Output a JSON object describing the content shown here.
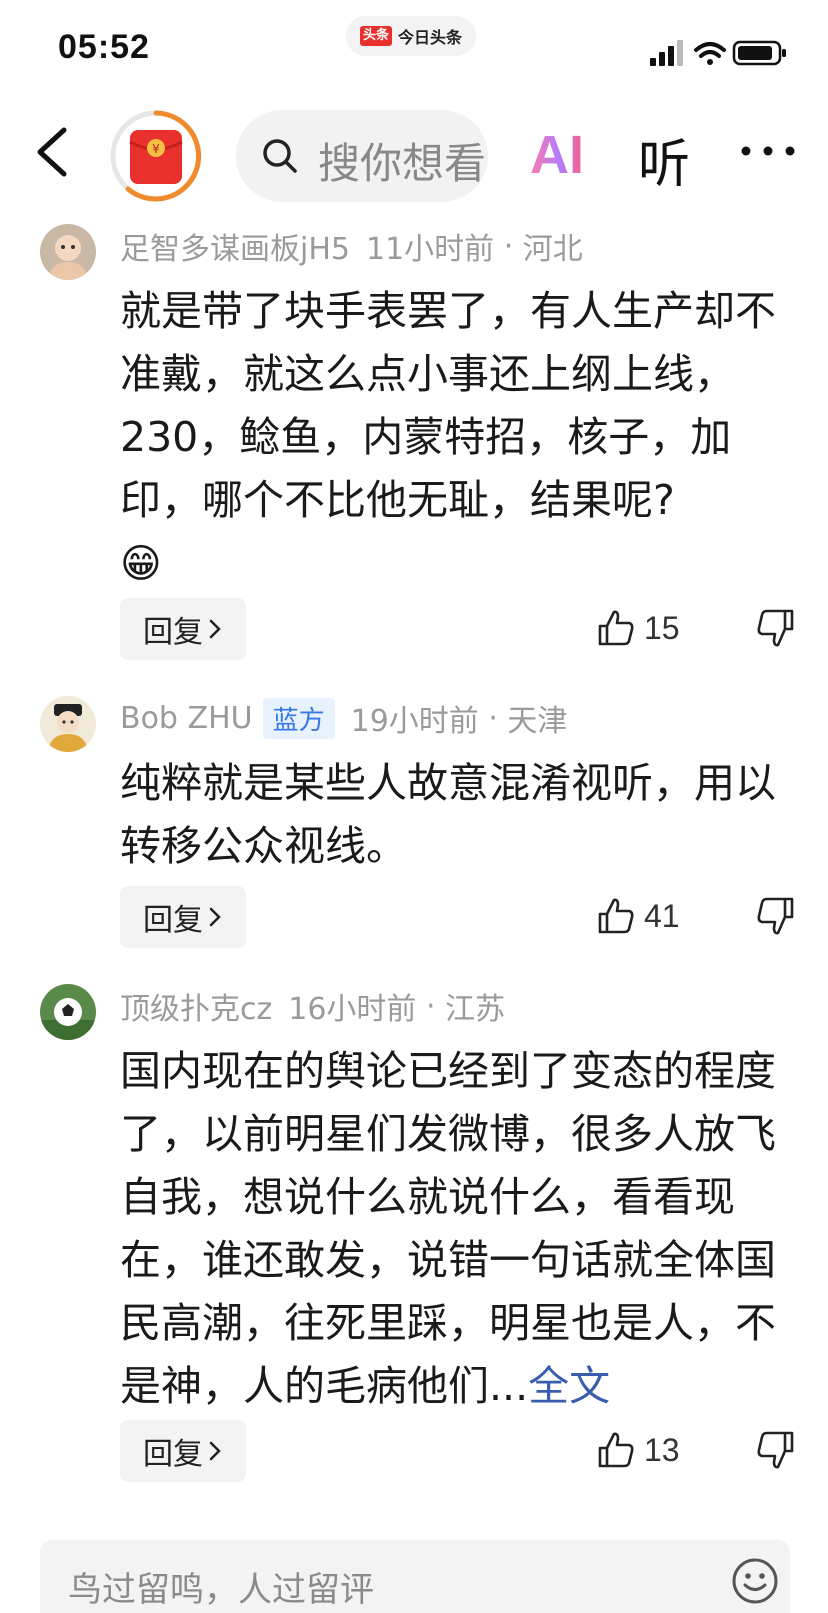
{
  "status_bar": {
    "time": "05:52",
    "app_logo": "头条",
    "app_name": "今日头条"
  },
  "nav": {
    "search_placeholder": "搜你想看",
    "ai_label": "AI",
    "listen_label": "听"
  },
  "comments": [
    {
      "username": "足智多谋画板jH5",
      "badge": "",
      "time": "11小时前",
      "location": "河北",
      "text": "就是带了块手表罢了，有人生产却不准戴，就这么点小事还上纲上线，230，鲶鱼，内蒙特招，核子，加印，哪个不比他无耻，结果呢?",
      "emoji": "😁",
      "more": "",
      "likes": "15",
      "reply_label": "回复"
    },
    {
      "username": "Bob ZHU",
      "badge": "蓝方",
      "time": "19小时前",
      "location": "天津",
      "text": "纯粹就是某些人故意混淆视听，用以转移公众视线。",
      "emoji": "",
      "more": "",
      "likes": "41",
      "reply_label": "回复"
    },
    {
      "username": "顶级扑克cz",
      "badge": "",
      "time": "16小时前",
      "location": "江苏",
      "text": "国内现在的舆论已经到了变态的程度了，以前明星们发微博，很多人放飞自我，想说什么就说什么，看看现在，谁还敢发，说错一句话就全体国民高潮，往死里踩，明星也是人，不是神，人的毛病他们...",
      "emoji": "",
      "more": "全文",
      "likes": "13",
      "reply_label": "回复"
    }
  ],
  "bottom": {
    "input_placeholder": "鸟过留鸣，人过留评"
  },
  "colors": {
    "accent_red": "#e8302c",
    "link_blue": "#3a5dae",
    "badge_blue": "#3478e6"
  },
  "icons": [
    "back-icon",
    "red-packet-icon",
    "search-icon",
    "more-icon",
    "chevron-right-icon",
    "thumbs-up-icon",
    "thumbs-down-icon",
    "emoji-icon",
    "signal-icon",
    "wifi-icon",
    "battery-icon"
  ]
}
